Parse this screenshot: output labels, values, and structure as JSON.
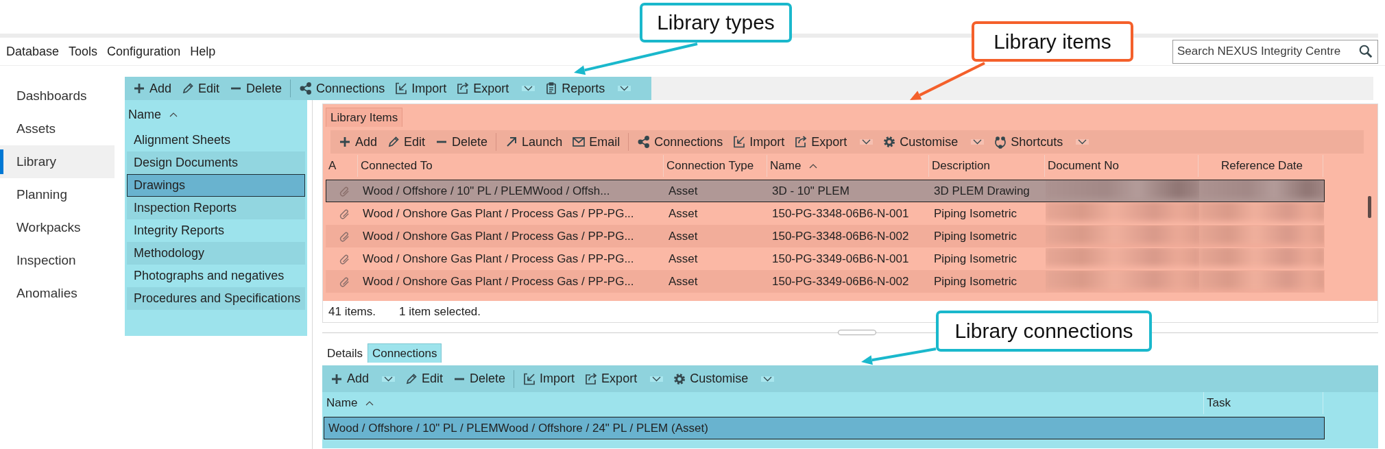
{
  "menu": [
    {
      "label": "Database"
    },
    {
      "label": "Tools"
    },
    {
      "label": "Configuration"
    },
    {
      "label": "Help"
    }
  ],
  "search": {
    "placeholder": "Search NEXUS Integrity Centre"
  },
  "sidebar": {
    "items": [
      {
        "label": "Dashboards",
        "selected": false
      },
      {
        "label": "Assets",
        "selected": false
      },
      {
        "label": "Library",
        "selected": true
      },
      {
        "label": "Planning",
        "selected": false
      },
      {
        "label": "Workpacks",
        "selected": false
      },
      {
        "label": "Inspection",
        "selected": false
      },
      {
        "label": "Anomalies",
        "selected": false
      }
    ]
  },
  "library_types": {
    "toolbar": {
      "groups": [
        {
          "buttons": [
            {
              "label": "Add",
              "dropdown": false
            },
            {
              "label": "Edit",
              "dropdown": false
            },
            {
              "label": "Delete",
              "dropdown": false
            }
          ]
        },
        {
          "buttons": [
            {
              "label": "Connections",
              "dropdown": false
            },
            {
              "label": "Import",
              "dropdown": false
            },
            {
              "label": "Export",
              "dropdown": true
            },
            {
              "label": "Reports",
              "dropdown": true
            }
          ]
        }
      ]
    },
    "column": {
      "label": "Name",
      "sorted": true
    },
    "items": [
      {
        "label": "Alignment Sheets",
        "selected": false
      },
      {
        "label": "Design Documents",
        "selected": false
      },
      {
        "label": "Drawings",
        "selected": true
      },
      {
        "label": "Inspection Reports",
        "selected": false
      },
      {
        "label": "Integrity Reports",
        "selected": false
      },
      {
        "label": "Methodology",
        "selected": false
      },
      {
        "label": "Photographs and negatives",
        "selected": false
      },
      {
        "label": "Procedures and Specifications",
        "selected": false
      }
    ]
  },
  "library_items": {
    "tabs": [
      {
        "label": "Library Items",
        "selected": true
      }
    ],
    "toolbar": {
      "groups": [
        {
          "buttons": [
            {
              "label": "Add",
              "dropdown": false
            },
            {
              "label": "Edit",
              "dropdown": false
            },
            {
              "label": "Delete",
              "dropdown": false
            }
          ]
        },
        {
          "buttons": [
            {
              "label": "Launch",
              "dropdown": false
            },
            {
              "label": "Email",
              "dropdown": false
            }
          ]
        },
        {
          "buttons": [
            {
              "label": "Connections",
              "dropdown": false
            },
            {
              "label": "Import",
              "dropdown": false
            },
            {
              "label": "Export",
              "dropdown": true
            },
            {
              "label": "Customise",
              "dropdown": true
            },
            {
              "label": "Shortcuts",
              "dropdown": true
            }
          ]
        }
      ]
    },
    "table": {
      "columns": [
        {
          "label": "A",
          "sorted": false
        },
        {
          "label": "Connected To",
          "sorted": false
        },
        {
          "label": "Connection Type",
          "sorted": false
        },
        {
          "label": "Name",
          "sorted": true
        },
        {
          "label": "Description",
          "sorted": false
        },
        {
          "label": "Document No",
          "sorted": false
        },
        {
          "label": "Reference Date",
          "sorted": false
        }
      ],
      "rows": [
        {
          "cells": [
            "",
            "Wood / Offshore / 10\" PL / PLEMWood / Offsh...",
            "Asset",
            "3D - 10\" PLEM",
            "3D PLEM Drawing"
          ],
          "selected": true
        },
        {
          "cells": [
            "",
            "Wood / Onshore Gas Plant / Process Gas / PP-PG...",
            "Asset",
            "150-PG-3348-06B6-N-001",
            "Piping Isometric"
          ],
          "selected": false
        },
        {
          "cells": [
            "",
            "Wood / Onshore Gas Plant / Process Gas / PP-PG...",
            "Asset",
            "150-PG-3348-06B6-N-002",
            "Piping Isometric"
          ],
          "selected": false
        },
        {
          "cells": [
            "",
            "Wood / Onshore Gas Plant / Process Gas / PP-PG...",
            "Asset",
            "150-PG-3349-06B6-N-001",
            "Piping Isometric"
          ],
          "selected": false
        },
        {
          "cells": [
            "",
            "Wood / Onshore Gas Plant / Process Gas / PP-PG...",
            "Asset",
            "150-PG-3349-06B6-N-002",
            "Piping Isometric"
          ],
          "selected": false
        }
      ]
    },
    "status": {
      "count": "41 items.",
      "selection": "1 item selected."
    }
  },
  "connections": {
    "tabs": [
      {
        "label": "Details",
        "selected": false
      },
      {
        "label": "Connections",
        "selected": true
      }
    ],
    "toolbar": {
      "groups": [
        {
          "buttons": [
            {
              "label": "Add",
              "dropdown": true
            },
            {
              "label": "Edit",
              "dropdown": false
            },
            {
              "label": "Delete",
              "dropdown": false
            }
          ]
        },
        {
          "buttons": [
            {
              "label": "Import",
              "dropdown": false
            },
            {
              "label": "Export",
              "dropdown": true
            },
            {
              "label": "Customise",
              "dropdown": true
            }
          ]
        }
      ]
    },
    "table": {
      "columns": [
        {
          "label": "Name",
          "sorted": true
        },
        {
          "label": "Task",
          "sorted": false
        }
      ],
      "rows": [
        {
          "cells": [
            "Wood / Offshore / 10\" PL / PLEMWood / Offshore / 24\" PL / PLEM (Asset)"
          ],
          "selected": true
        }
      ]
    }
  },
  "callouts": [
    {
      "text": "Library types",
      "color": "#1ab8cc"
    },
    {
      "text": "Library items",
      "color": "#f4602b"
    },
    {
      "text": "Library connections",
      "color": "#1ab8cc"
    }
  ]
}
